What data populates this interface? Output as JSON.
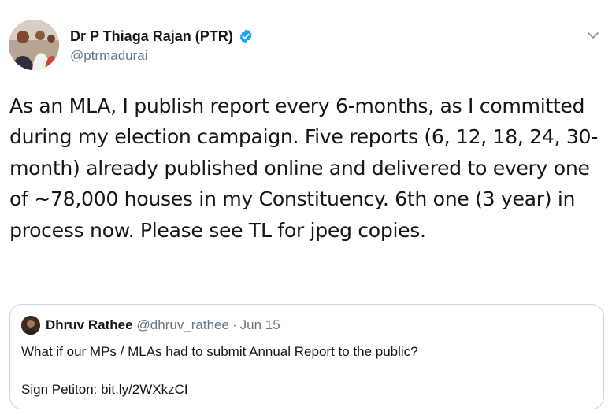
{
  "author": {
    "display_name": "Dr P Thiaga Rajan (PTR)",
    "handle": "@ptrmadurai",
    "verified": true
  },
  "tweet_text": "As an MLA, I publish report every 6-months, as I committed during my election campaign. Five reports (6, 12, 18, 24, 30-month) already published online and delivered to every one of ~78,000 houses in my Constituency. 6th one (3 year) in process now. Please see TL for jpeg copies.",
  "quoted_tweet": {
    "display_name": "Dhruv Rathee",
    "handle": "@dhruv_rathee",
    "separator": "·",
    "date": "Jun 15",
    "text_line1": "What if our MPs / MLAs had to submit Annual Report to the public?",
    "text_line2": "Sign Petiton: bit.ly/2WXkzCI"
  },
  "icons": {
    "verified": "verified-badge-icon",
    "menu": "chevron-down-icon"
  },
  "colors": {
    "verified_blue": "#1da1f2",
    "secondary_text": "#657786",
    "border": "#ccd6dd"
  }
}
